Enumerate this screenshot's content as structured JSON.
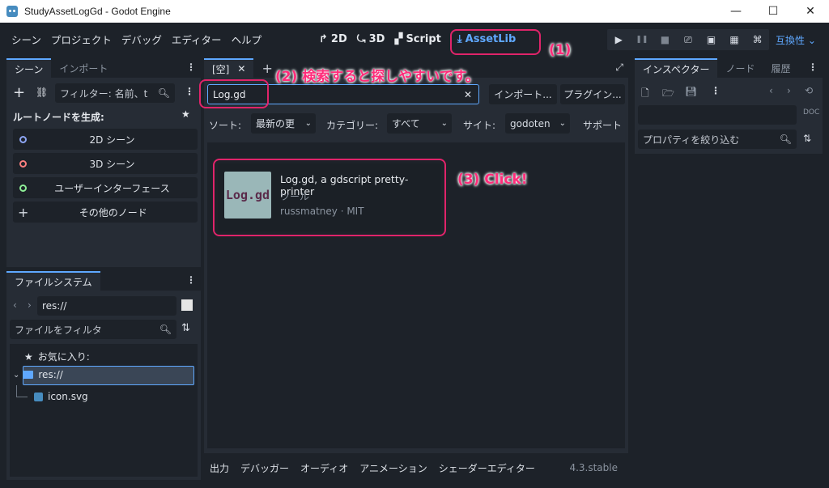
{
  "window": {
    "title": "StudyAssetLogGd - Godot Engine",
    "minimize": "—",
    "maximize": "☐",
    "close": "✕"
  },
  "menu": [
    "シーン",
    "プロジェクト",
    "デバッグ",
    "エディター",
    "ヘルプ"
  ],
  "modes": [
    {
      "glyph": "↱",
      "label": "2D"
    },
    {
      "glyph": "⤿",
      "label": "3D"
    },
    {
      "glyph": "▞",
      "label": "Script"
    },
    {
      "glyph": "⤓",
      "label": "AssetLib"
    }
  ],
  "play_controls": [
    "▶",
    "❚❚",
    "■",
    "⎚",
    "▣",
    "▦",
    "⌘"
  ],
  "renderer": "互換性 ⌄",
  "scene_panel": {
    "tabs": [
      "シーン",
      "インポート"
    ],
    "filter_placeholder": "フィルター: 名前、t",
    "create_root": "ルートノードを生成:",
    "buttons": [
      {
        "label": "2D シーン",
        "color": "#8da5f3"
      },
      {
        "label": "3D シーン",
        "color": "#fc7f7f"
      },
      {
        "label": "ユーザーインターフェース",
        "color": "#8eef97"
      },
      {
        "label": "その他のノード",
        "color": "#e0e0e0"
      }
    ]
  },
  "filesystem": {
    "tab": "ファイルシステム",
    "path": "res://",
    "filter_placeholder": "ファイルをフィルタ",
    "favorites": "お気に入り:",
    "root": "res://",
    "file": "icon.svg"
  },
  "center": {
    "scene_tab": "[空]",
    "search_value": "Log.gd",
    "import_btn": "インポート...",
    "plugins_btn": "プラグイン...",
    "sort_label": "ソート:",
    "sort_value": "最新の更",
    "category_label": "カテゴリー:",
    "category_value": "すべて",
    "site_label": "サイト:",
    "site_value": "godoten",
    "support_label": "サポート",
    "asset": {
      "title": "Log.gd, a gdscript pretty-printer",
      "category": "ツール",
      "author": "russmatney · MIT",
      "icon_text": "Log.gd"
    }
  },
  "bottom_tabs": [
    "出力",
    "デバッガー",
    "オーディオ",
    "アニメーション",
    "シェーダーエディター"
  ],
  "version": "4.3.stable",
  "inspector": {
    "tabs": [
      "インスペクター",
      "ノード",
      "履歴"
    ],
    "filter_placeholder": "プロパティを絞り込む"
  },
  "annotations": {
    "a1": "(1)",
    "a2": "(2) 検索すると探しやすいです。",
    "a3": "(3) Click!"
  },
  "colors": {
    "accent": "#5fa8ff",
    "highlight": "#e0246a"
  }
}
